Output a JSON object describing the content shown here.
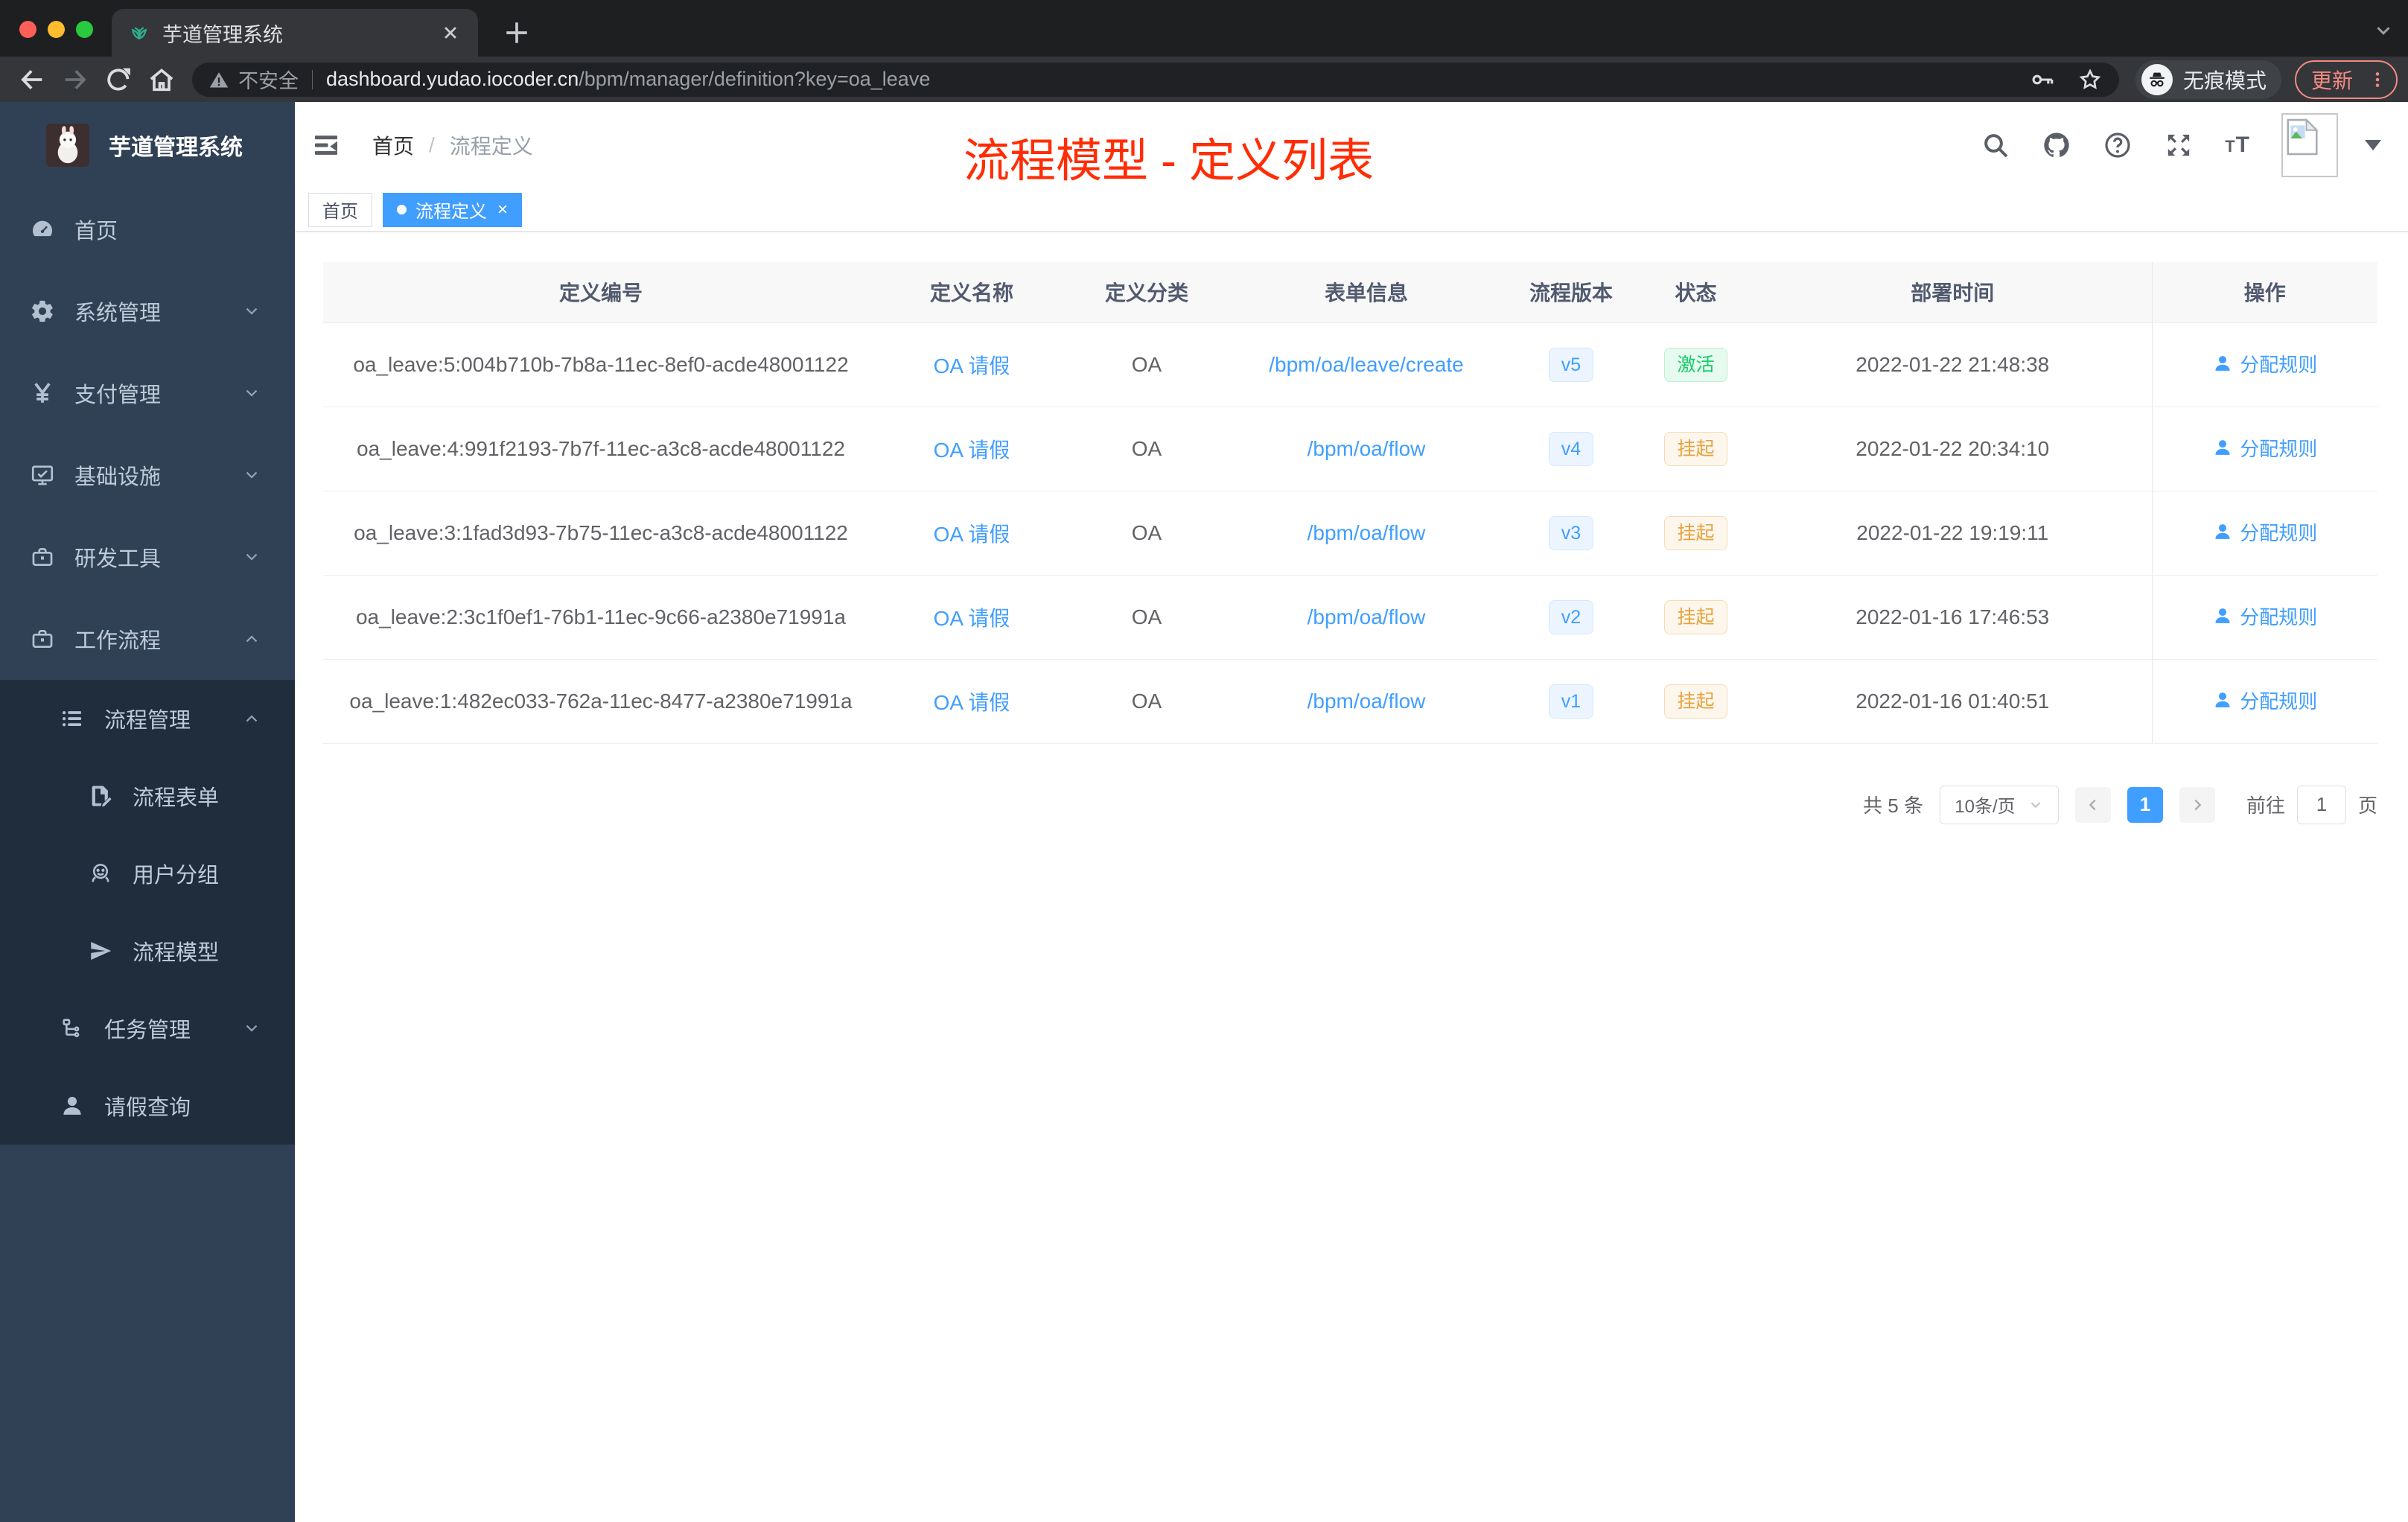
{
  "colors": {
    "primary": "#409eff",
    "annotation_red": "#ff2d05",
    "status_active": "#13ce66",
    "status_suspend": "#e6a23c",
    "sidebar_bg": "#304156",
    "submenu_bg": "#1f2d3d"
  },
  "browser": {
    "tab": {
      "title": "芋道管理系统"
    },
    "toolbar": {
      "security": "不安全",
      "domain": "dashboard.yudao.iocoder.cn",
      "path": "/bpm/manager/definition?key=oa_leave",
      "incognito": "无痕模式",
      "update": "更新"
    }
  },
  "app": {
    "sidebar": {
      "title": "芋道管理系统",
      "menu": [
        {
          "label": "首页",
          "icon": "dashboard-icon"
        },
        {
          "label": "系统管理",
          "icon": "gear-icon",
          "chevron": "down"
        },
        {
          "label": "支付管理",
          "icon": "yen-icon",
          "chevron": "down"
        },
        {
          "label": "基础设施",
          "icon": "monitor-icon",
          "chevron": "down"
        },
        {
          "label": "研发工具",
          "icon": "toolbox-icon",
          "chevron": "down"
        },
        {
          "label": "工作流程",
          "icon": "workflow-icon",
          "chevron": "up"
        }
      ],
      "submenu": [
        {
          "label": "流程管理",
          "icon": "list-icon",
          "level": 2,
          "chevron": "up"
        },
        {
          "label": "流程表单",
          "icon": "form-icon",
          "level": 3
        },
        {
          "label": "用户分组",
          "icon": "user-group-icon",
          "level": 3
        },
        {
          "label": "流程模型",
          "icon": "paper-plane-icon",
          "level": 3
        },
        {
          "label": "任务管理",
          "icon": "tasks-icon",
          "level": 2,
          "chevron": "down"
        },
        {
          "label": "请假查询",
          "icon": "person-icon",
          "level": 2
        }
      ]
    },
    "navbar": {
      "breadcrumb": {
        "home": "首页",
        "sep": "/",
        "current": "流程定义"
      }
    },
    "annotation": {
      "text": "流程模型 - 定义列表"
    },
    "tags": [
      {
        "label": "首页",
        "active": false,
        "closable": false
      },
      {
        "label": "流程定义",
        "active": true,
        "closable": true
      }
    ],
    "table": {
      "columns": [
        "定义编号",
        "定义名称",
        "定义分类",
        "表单信息",
        "流程版本",
        "状态",
        "部署时间",
        "操作"
      ],
      "action_label": "分配规则",
      "rows": [
        {
          "id": "oa_leave:5:004b710b-7b8a-11ec-8ef0-acde48001122",
          "name": "OA 请假",
          "category": "OA",
          "form": "/bpm/oa/leave/create",
          "version": "v5",
          "status": "激活",
          "status_type": "success",
          "deploy_time": "2022-01-22 21:48:38"
        },
        {
          "id": "oa_leave:4:991f2193-7b7f-11ec-a3c8-acde48001122",
          "name": "OA 请假",
          "category": "OA",
          "form": "/bpm/oa/flow",
          "version": "v4",
          "status": "挂起",
          "status_type": "warning",
          "deploy_time": "2022-01-22 20:34:10"
        },
        {
          "id": "oa_leave:3:1fad3d93-7b75-11ec-a3c8-acde48001122",
          "name": "OA 请假",
          "category": "OA",
          "form": "/bpm/oa/flow",
          "version": "v3",
          "status": "挂起",
          "status_type": "warning",
          "deploy_time": "2022-01-22 19:19:11"
        },
        {
          "id": "oa_leave:2:3c1f0ef1-76b1-11ec-9c66-a2380e71991a",
          "name": "OA 请假",
          "category": "OA",
          "form": "/bpm/oa/flow",
          "version": "v2",
          "status": "挂起",
          "status_type": "warning",
          "deploy_time": "2022-01-16 17:46:53"
        },
        {
          "id": "oa_leave:1:482ec033-762a-11ec-8477-a2380e71991a",
          "name": "OA 请假",
          "category": "OA",
          "form": "/bpm/oa/flow",
          "version": "v1",
          "status": "挂起",
          "status_type": "warning",
          "deploy_time": "2022-01-16 01:40:51"
        }
      ]
    },
    "pagination": {
      "total": "共 5 条",
      "size": "10条/页",
      "page": "1",
      "goto_prefix": "前往",
      "goto_value": "1",
      "goto_suffix": "页"
    }
  }
}
